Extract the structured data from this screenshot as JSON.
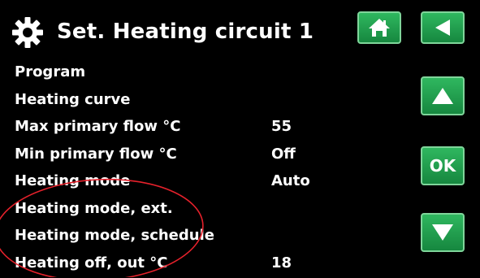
{
  "header": {
    "title": "Set. Heating circuit 1"
  },
  "icons": {
    "settings": "gear-icon",
    "home": "home-icon",
    "back": "back-arrow-icon",
    "up": "up-arrow-icon",
    "down": "down-arrow-icon"
  },
  "buttons": {
    "ok_label": "OK"
  },
  "menu": [
    {
      "label": "Program",
      "value": ""
    },
    {
      "label": "Heating curve",
      "value": ""
    },
    {
      "label": "Max primary flow °C",
      "value": "55"
    },
    {
      "label": "Min primary flow °C",
      "value": "Off"
    },
    {
      "label": "Heating mode",
      "value": "Auto"
    },
    {
      "label": "Heating mode, ext.",
      "value": ""
    },
    {
      "label": "Heating mode, schedule",
      "value": ""
    },
    {
      "label": "Heating off, out °C",
      "value": "18"
    }
  ],
  "colors": {
    "button": "#22a14f",
    "annotation": "#e5212b",
    "background": "#000000"
  }
}
